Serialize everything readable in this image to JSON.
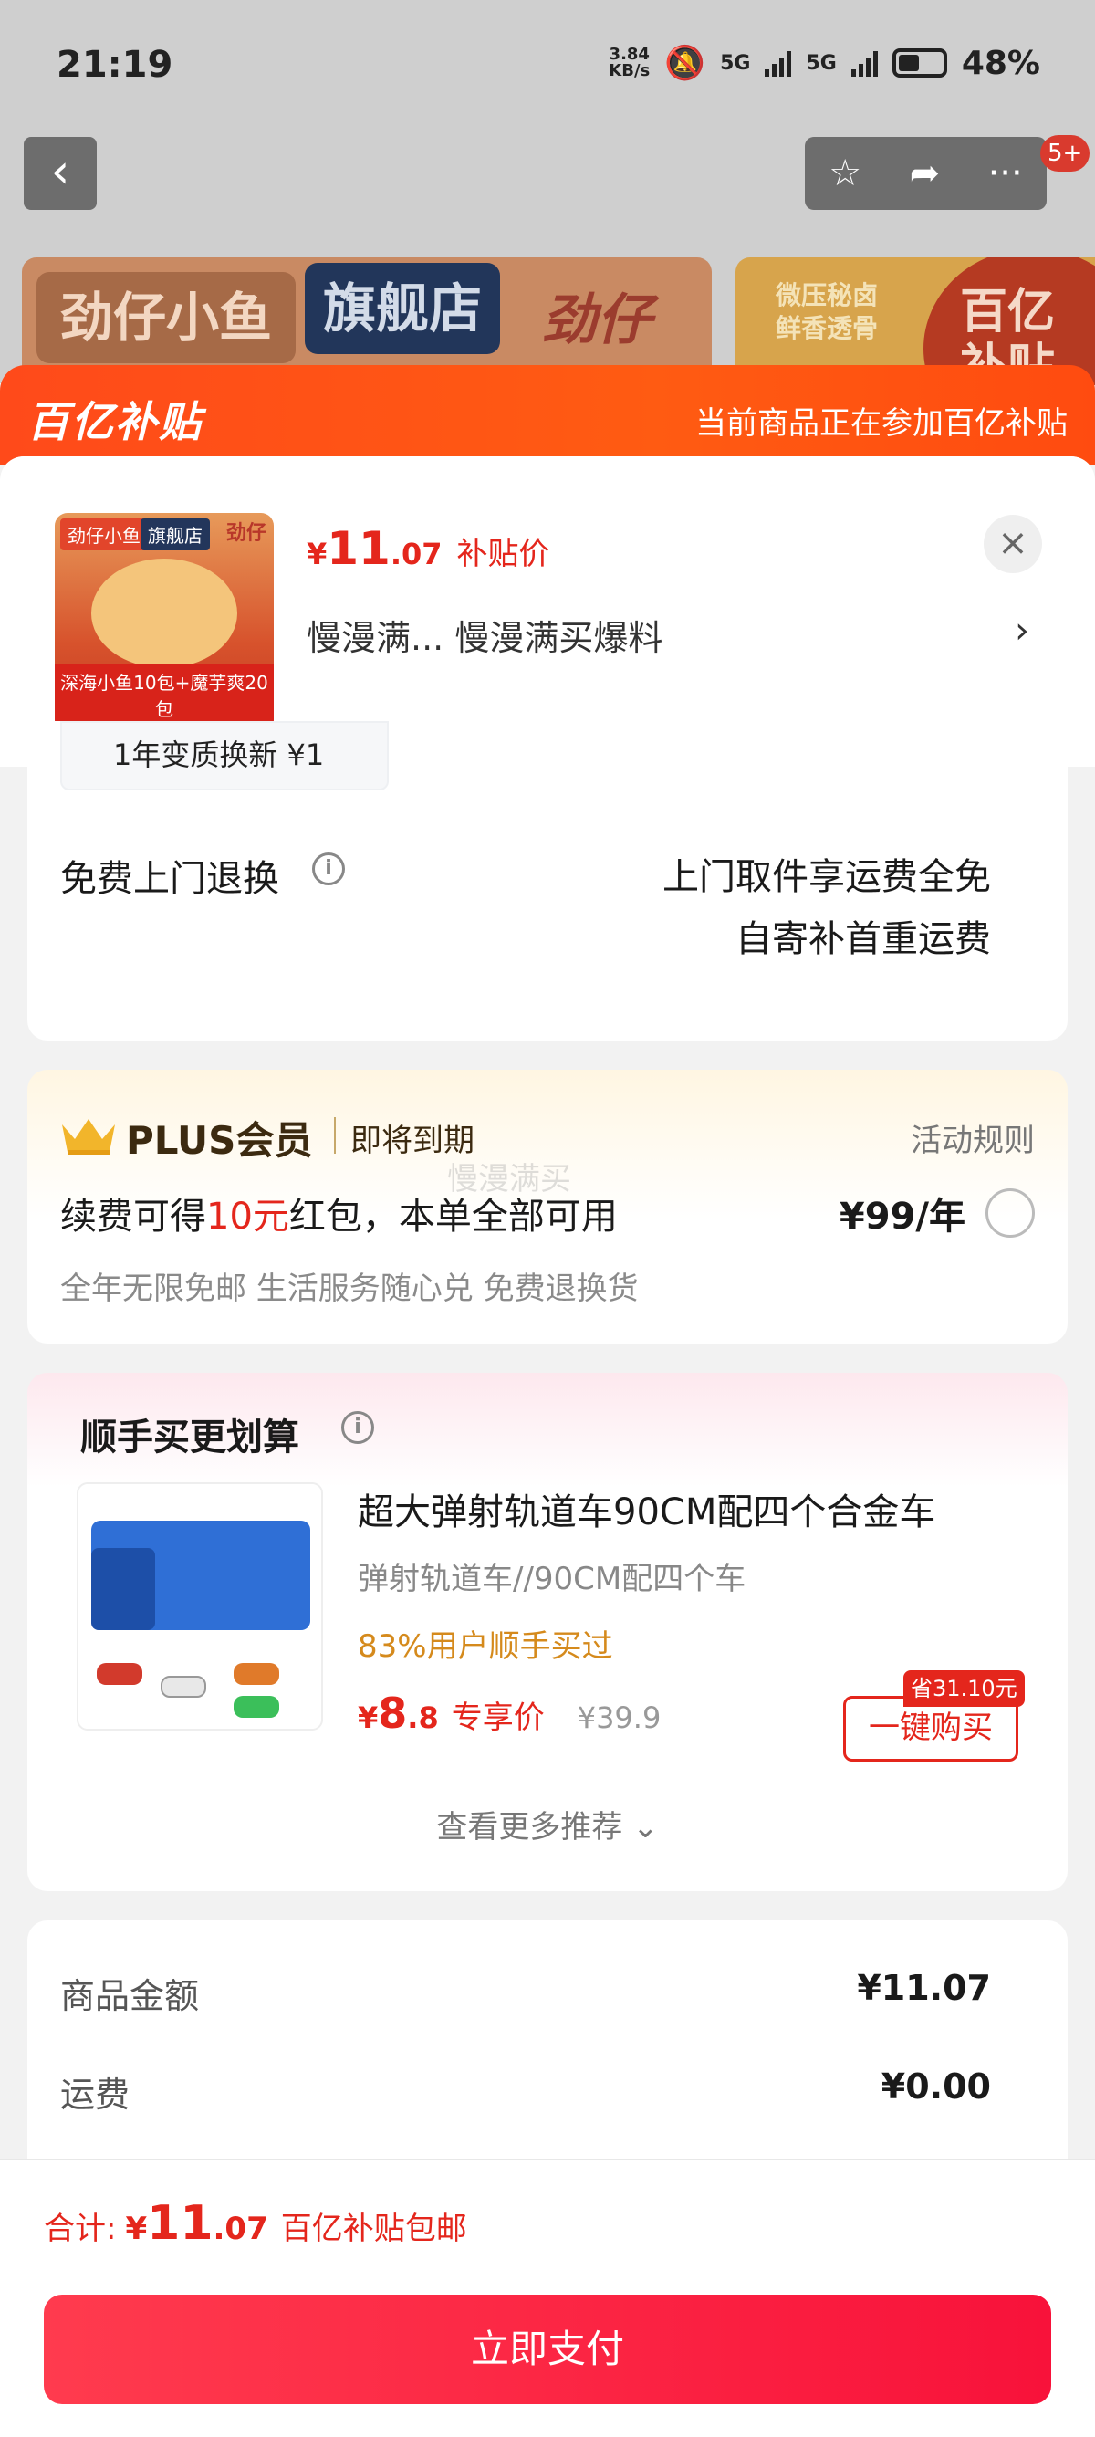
{
  "status_bar": {
    "time": "21:19",
    "net_speed_top": "3.84",
    "net_speed_bottom": "KB/s",
    "net1": "5G",
    "net2": "5G",
    "battery": "48%"
  },
  "nav": {
    "back_glyph": "‹",
    "fav_glyph": "☆",
    "share_glyph": "➦",
    "more_glyph": "···",
    "badge": "5+"
  },
  "bg_banner": {
    "brand": "劲仔小鱼",
    "flagship": "旗舰店",
    "logo": "劲仔",
    "promo_line1": "微压秘卤",
    "promo_line2": "鲜香透骨",
    "subsidy_line1": "百亿",
    "subsidy_line2": "补贴"
  },
  "sheet": {
    "logo": "百亿补贴",
    "note": "当前商品正在参加百亿补贴"
  },
  "product": {
    "thumb_tag1": "劲仔小鱼",
    "thumb_tag2": "旗舰店",
    "thumb_logo": "劲仔",
    "thumb_footer": "深海小鱼10包+魔芋爽20包",
    "price_currency": "¥",
    "price_int": "11",
    "price_dec": ".07",
    "price_label": "补贴价",
    "variant": "慢漫满... 慢漫满买爆料",
    "close_glyph": "×",
    "chevron": "›"
  },
  "service": {
    "chip": "1年变质换新  ¥1",
    "label": "免费上门退换",
    "info_glyph": "i",
    "right_line1": "上门取件享运费全免",
    "right_line2": "自寄补首重运费"
  },
  "plus": {
    "title": "PLUS会员",
    "state": "即将到期",
    "rules": "活动规则",
    "line_pre": "续费可得",
    "line_hl": "10元",
    "line_post": "红包，本单全部可用",
    "price": "¥99/年",
    "sub": "全年无限免邮 生活服务随心兑 免费退换货",
    "watermark": "慢漫满买"
  },
  "recommend": {
    "title": "顺手买更划算",
    "info_glyph": "i",
    "name": "超大弹射轨道车90CM配四个合金车",
    "spec": "弹射轨道车//90CM配四个车",
    "buyers": "83%用户顺手买过",
    "price_currency": "¥",
    "price_int": "8",
    "price_dec": ".8",
    "price_label": "专享价",
    "orig_price": "¥39.9",
    "save_tag": "省31.10元",
    "buy_label": "一键购买",
    "more": "查看更多推荐 ⌄"
  },
  "totals": {
    "goods_label": "商品金额",
    "goods_value": "¥11.07",
    "shipping_label": "运费",
    "shipping_value": "¥0.00"
  },
  "footer": {
    "sum_label": "合计:",
    "sum_currency": "¥",
    "sum_int": "11",
    "sum_dec": ".07",
    "sum_note": "百亿补贴包邮",
    "pay_label": "立即支付"
  }
}
